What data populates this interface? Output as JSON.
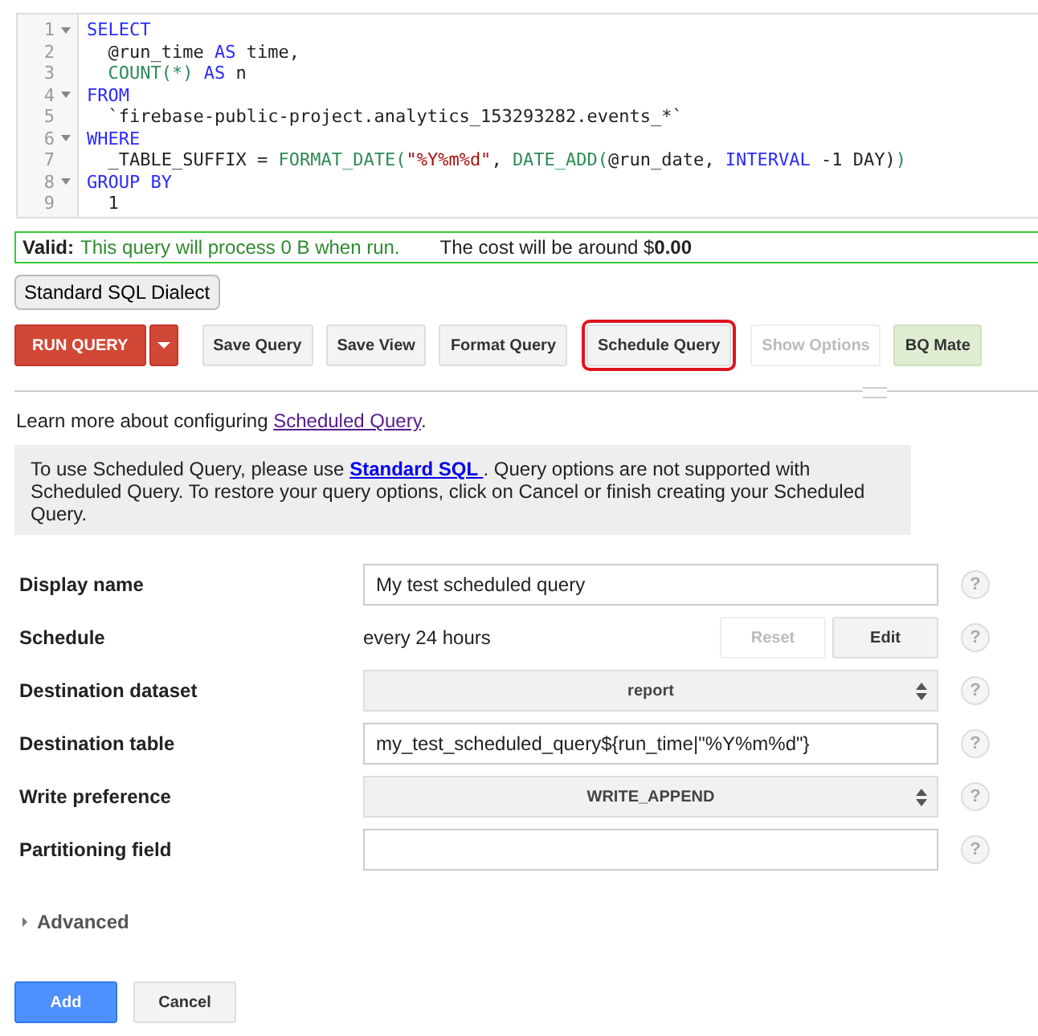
{
  "editor": {
    "lines": [
      {
        "number": "1",
        "foldable": true,
        "tokens": [
          {
            "kind": "keyword",
            "text": "SELECT"
          }
        ]
      },
      {
        "number": "2",
        "foldable": false,
        "tokens": [
          {
            "kind": "plain",
            "text": "  @run_time "
          },
          {
            "kind": "keyword",
            "text": "AS"
          },
          {
            "kind": "plain",
            "text": " time,"
          }
        ]
      },
      {
        "number": "3",
        "foldable": false,
        "tokens": [
          {
            "kind": "function",
            "text": "  COUNT(*)"
          },
          {
            "kind": "keyword",
            "text": " AS"
          },
          {
            "kind": "plain",
            "text": " n"
          }
        ]
      },
      {
        "number": "4",
        "foldable": true,
        "tokens": [
          {
            "kind": "keyword",
            "text": "FROM"
          }
        ]
      },
      {
        "number": "5",
        "foldable": false,
        "tokens": [
          {
            "kind": "plain",
            "text": "  `firebase-public-project.analytics_153293282.events_*`"
          }
        ]
      },
      {
        "number": "6",
        "foldable": true,
        "tokens": [
          {
            "kind": "keyword",
            "text": "WHERE"
          }
        ]
      },
      {
        "number": "7",
        "foldable": false,
        "tokens": [
          {
            "kind": "plain",
            "text": "  _TABLE_SUFFIX = "
          },
          {
            "kind": "function",
            "text": "FORMAT_DATE("
          },
          {
            "kind": "string",
            "text": "\"%Y%m%d\""
          },
          {
            "kind": "plain",
            "text": ", "
          },
          {
            "kind": "function",
            "text": "DATE_ADD("
          },
          {
            "kind": "plain",
            "text": "@run_date, "
          },
          {
            "kind": "keyword",
            "text": "INTERVAL"
          },
          {
            "kind": "plain",
            "text": " -1 DAY)"
          },
          {
            "kind": "function",
            "text": ")"
          }
        ]
      },
      {
        "number": "8",
        "foldable": true,
        "tokens": [
          {
            "kind": "keyword",
            "text": "GROUP BY"
          }
        ]
      },
      {
        "number": "9",
        "foldable": false,
        "tokens": [
          {
            "kind": "plain",
            "text": "  1"
          }
        ]
      }
    ]
  },
  "validation": {
    "label": "Valid:",
    "message": "This query will process 0 B when run.",
    "cost": "The cost will be around $**0.00**"
  },
  "dialect_button": "Standard SQL Dialect",
  "toolbar": [
    {
      "kind": "run",
      "label": "RUN QUERY",
      "disabled": false,
      "outlined": false
    },
    {
      "kind": "default",
      "label": "Save Query",
      "disabled": false,
      "outlined": false
    },
    {
      "kind": "default",
      "label": "Save View",
      "disabled": false,
      "outlined": false
    },
    {
      "kind": "default",
      "label": "Format Query",
      "disabled": false,
      "outlined": false
    },
    {
      "kind": "default",
      "label": "Schedule Query",
      "disabled": false,
      "outlined": true
    },
    {
      "kind": "default",
      "label": "Show Options",
      "disabled": true,
      "outlined": false
    },
    {
      "kind": "mate",
      "label": "BQ Mate",
      "disabled": false,
      "outlined": false
    }
  ],
  "learn_more": {
    "text": "Learn more about configuring ",
    "link": "Scheduled Query",
    "end": "."
  },
  "notice": {
    "before": "To use Scheduled Query, please use ",
    "link": "Standard SQL ",
    "after": ". Query options are not supported with Scheduled Query. To restore your query options, click on Cancel or finish creating your Scheduled Query."
  },
  "form": [
    {
      "kind": "text",
      "label": "Display name",
      "value": "My test scheduled query",
      "help": "?"
    },
    {
      "kind": "static",
      "label": "Schedule",
      "value": "every 24 hours",
      "buttons": [
        {
          "label": "Reset",
          "disabled": true
        },
        {
          "label": "Edit",
          "disabled": false
        }
      ],
      "help": "?"
    },
    {
      "kind": "select",
      "label": "Destination dataset",
      "value": "report",
      "help": "?"
    },
    {
      "kind": "text",
      "label": "Destination table",
      "value": "my_test_scheduled_query${run_time|\"%Y%m%d\"}",
      "help": "?"
    },
    {
      "kind": "select",
      "label": "Write preference",
      "value": "WRITE_APPEND",
      "help": "?"
    },
    {
      "kind": "text",
      "label": "Partitioning field",
      "help": "?"
    }
  ],
  "advanced": {
    "label": "Advanced",
    "expanded": false
  },
  "actions": [
    {
      "kind": "primary",
      "label": "Add"
    },
    {
      "kind": "default",
      "label": "Cancel"
    }
  ]
}
